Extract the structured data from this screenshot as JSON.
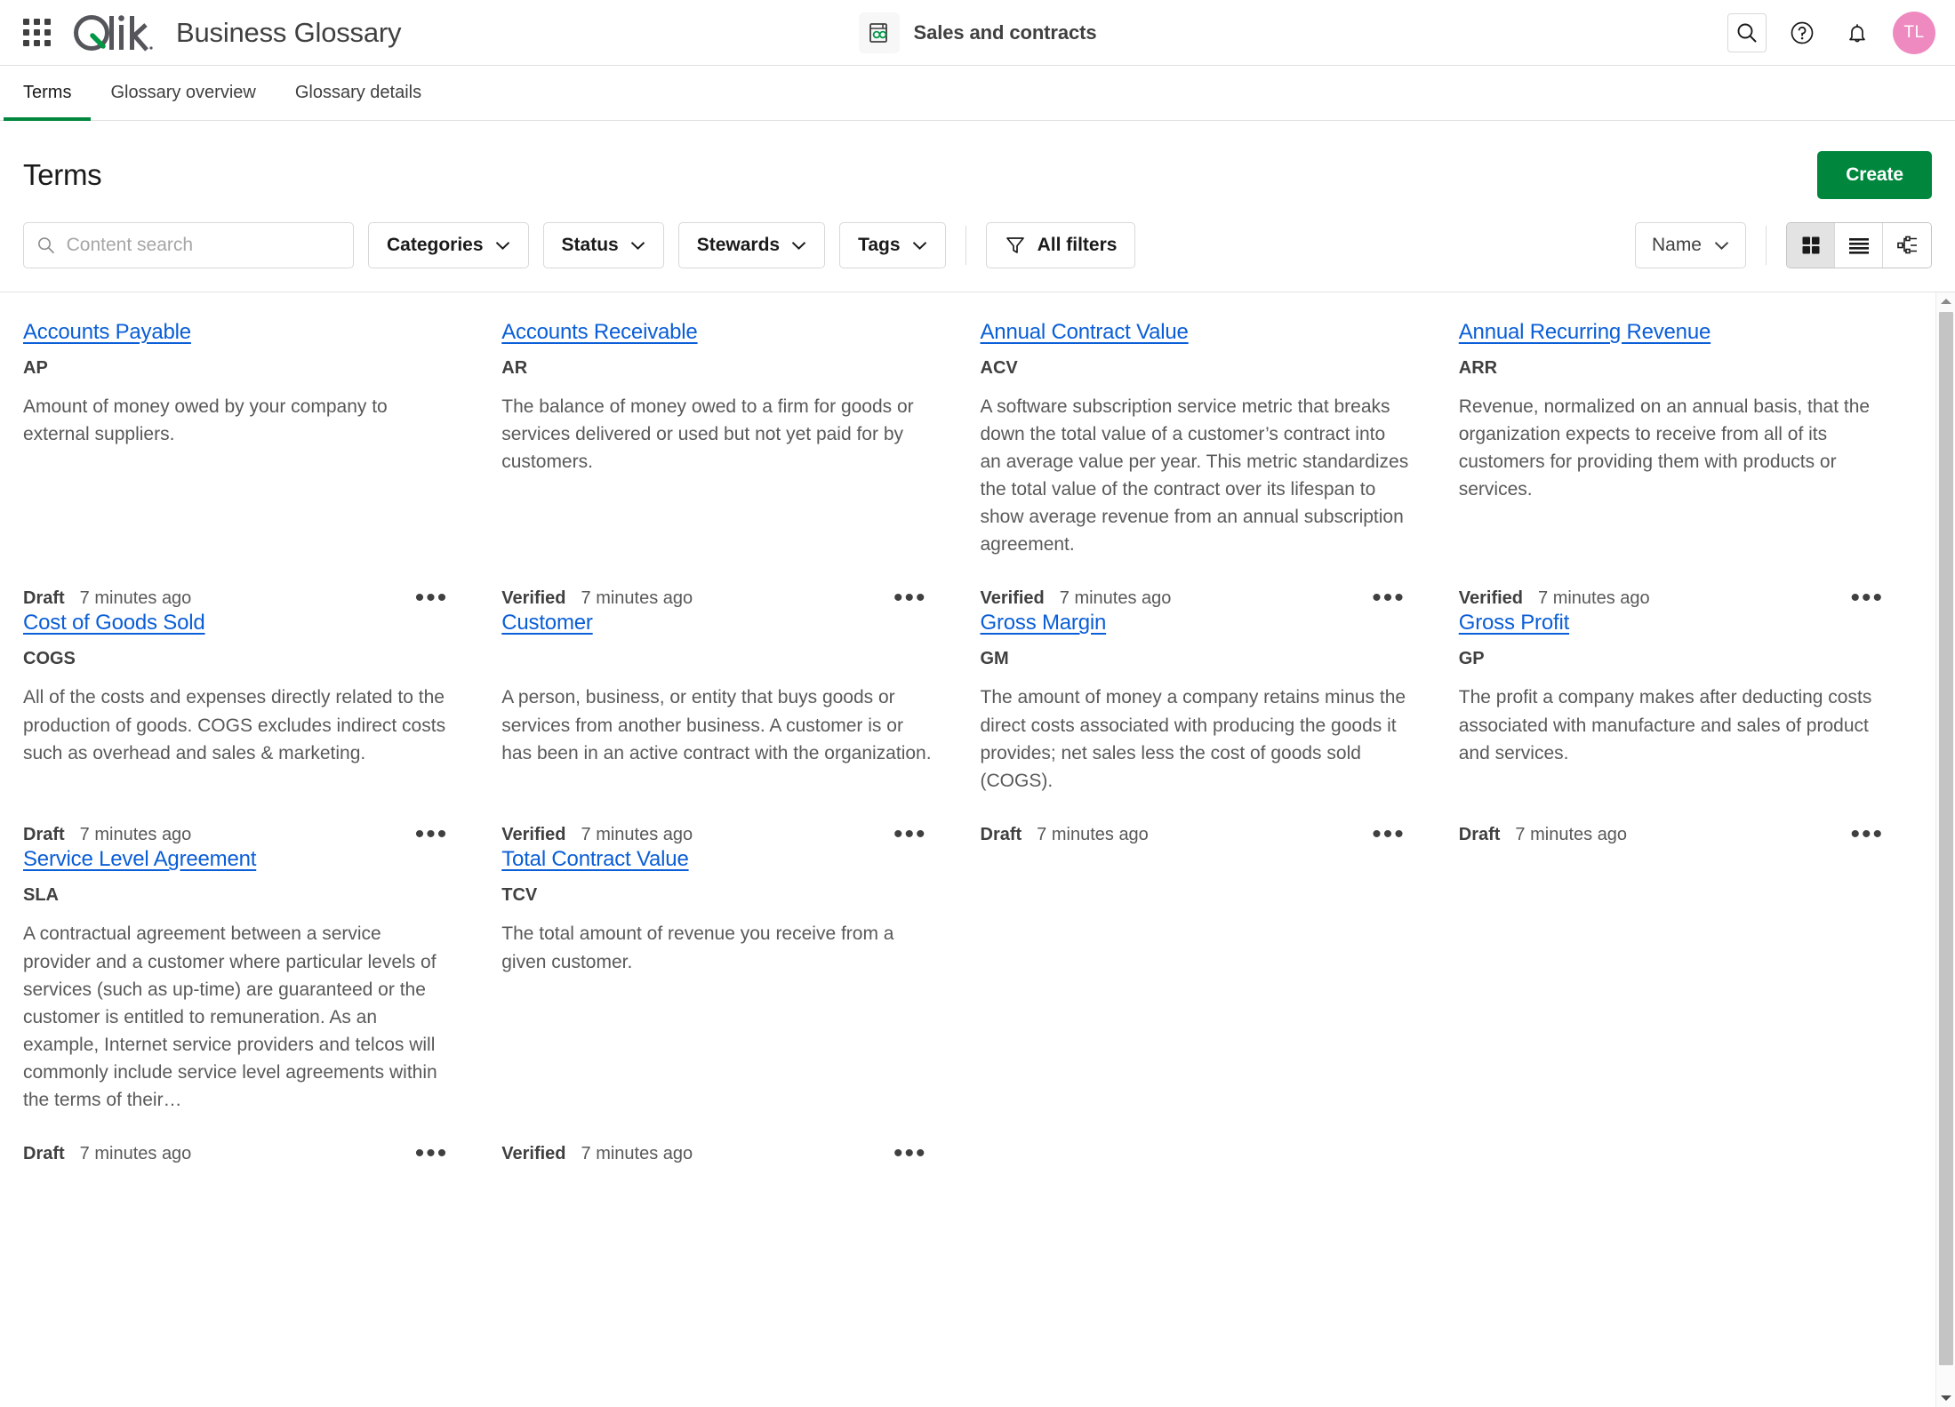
{
  "topbar": {
    "waffle_label": "app-launcher",
    "logo_text": "Qlik",
    "app_title": "Business Glossary",
    "space_name": "Sales and contracts",
    "avatar_initials": "TL",
    "icons": {
      "search": "search-icon",
      "help": "help-circle-icon",
      "notifications": "bell-icon"
    }
  },
  "tabs": [
    {
      "label": "Terms",
      "active": true
    },
    {
      "label": "Glossary overview",
      "active": false
    },
    {
      "label": "Glossary details",
      "active": false
    }
  ],
  "page": {
    "title": "Terms",
    "create_label": "Create"
  },
  "filters": {
    "search_placeholder": "Content search",
    "search_value": "",
    "categories_label": "Categories",
    "status_label": "Status",
    "stewards_label": "Stewards",
    "tags_label": "Tags",
    "all_filters_label": "All filters",
    "sort_label": "Name",
    "views": {
      "grid": "grid-view",
      "list": "list-view",
      "tree": "tree-view",
      "active": "grid"
    }
  },
  "colors": {
    "accent_green": "#00873d",
    "link_blue": "#0a5ed7",
    "avatar_pink": "#ef8ac1",
    "qlik_green": "#009845"
  },
  "terms": [
    {
      "name": "Accounts Payable",
      "abbreviation": "AP",
      "description": "Amount of money owed by your company to external suppliers.",
      "status": "Draft",
      "updated": "7 minutes ago"
    },
    {
      "name": "Accounts Receivable",
      "abbreviation": "AR",
      "description": "The balance of money owed to a firm for goods or services delivered or used but not yet paid for by customers.",
      "status": "Verified",
      "updated": "7 minutes ago"
    },
    {
      "name": "Annual Contract Value",
      "abbreviation": "ACV",
      "description": "A software subscription service metric that breaks down the total value of a customer’s contract into an average value per year. This metric standardizes the total value of the contract over its lifespan to show average revenue from an annual subscription agreement.",
      "status": "Verified",
      "updated": "7 minutes ago"
    },
    {
      "name": "Annual Recurring Revenue",
      "abbreviation": "ARR",
      "description": "Revenue, normalized on an annual basis, that the organization expects to receive from all of its customers for providing them with products or services.",
      "status": "Verified",
      "updated": "7 minutes ago"
    },
    {
      "name": "Cost of Goods Sold",
      "abbreviation": "COGS",
      "description": "All of the costs and expenses directly related to the production of goods. COGS excludes indirect costs such as overhead and sales & marketing.",
      "status": "Draft",
      "updated": "7 minutes ago"
    },
    {
      "name": "Customer",
      "abbreviation": "",
      "description": "A person, business, or entity that buys goods or services from another business. A customer is or has been in an active contract with the organization.",
      "status": "Verified",
      "updated": "7 minutes ago"
    },
    {
      "name": "Gross Margin",
      "abbreviation": "GM",
      "description": "The amount of money a company retains minus the direct costs associated with producing the goods it provides; net sales less the cost of goods sold (COGS).",
      "status": "Draft",
      "updated": "7 minutes ago"
    },
    {
      "name": "Gross Profit",
      "abbreviation": "GP",
      "description": "The profit a company makes after deducting costs associated with manufacture and sales of product and services.",
      "status": "Draft",
      "updated": "7 minutes ago"
    },
    {
      "name": "Service Level Agreement",
      "abbreviation": "SLA",
      "description": "A contractual agreement between a service provider and a customer where particular levels of services (such as up-time) are guaranteed or the customer is entitled to remuneration. As an example, Internet service providers and telcos will commonly include service level agreements within the terms of their…",
      "status": "Draft",
      "updated": "7 minutes ago"
    },
    {
      "name": "Total Contract Value",
      "abbreviation": "TCV",
      "description": "The total amount of revenue you receive from a given customer.",
      "status": "Verified",
      "updated": "7 minutes ago"
    }
  ]
}
